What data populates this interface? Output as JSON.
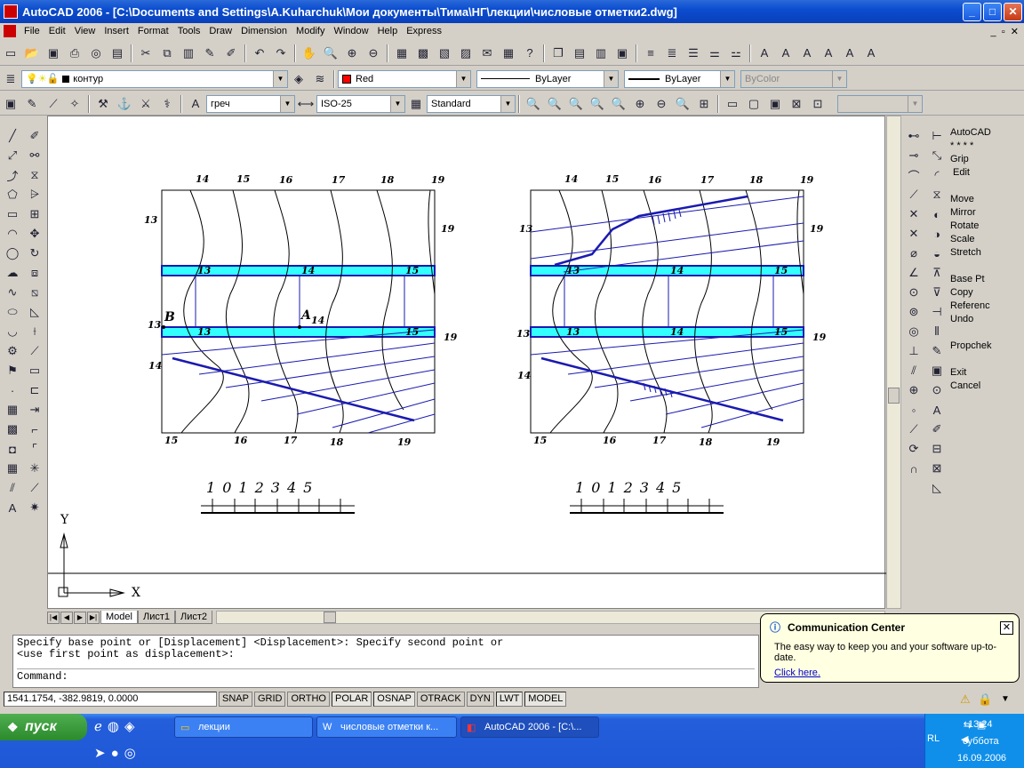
{
  "title": "AutoCAD 2006 - [C:\\Documents and Settings\\A.Kuharchuk\\Мои документы\\Тима\\НГ\\лекции\\числовые отметки2.dwg]",
  "menu": [
    "File",
    "Edit",
    "View",
    "Insert",
    "Format",
    "Tools",
    "Draw",
    "Dimension",
    "Modify",
    "Window",
    "Help",
    "Express"
  ],
  "layers": {
    "layer_name": "контур",
    "color": "Red",
    "linetype": "ByLayer",
    "lineweight": "ByLayer",
    "plotstyle": "ByColor"
  },
  "styles": {
    "text_style": "греч",
    "dim_style": "ISO-25",
    "table_style": "Standard"
  },
  "right_menu": [
    "AutoCAD",
    "* * * *",
    "Grip",
    "Edit",
    "",
    "Move",
    "Mirror",
    "Rotate",
    "Scale",
    "Stretch",
    "",
    "Base Pt",
    "Copy",
    "Referenc",
    "Undo",
    "",
    "Propchek",
    "",
    "Exit",
    "Cancel"
  ],
  "tabs": [
    "Model",
    "Лист1",
    "Лист2"
  ],
  "command": {
    "line1": "Specify base point or [Displacement] <Displacement>: Specify second point or",
    "line2": "<use first point as displacement>:",
    "prompt": "Command:"
  },
  "status": {
    "coords": "1541.1754, -382.9819, 0.0000",
    "buttons": [
      {
        "label": "SNAP",
        "on": false
      },
      {
        "label": "GRID",
        "on": false
      },
      {
        "label": "ORTHO",
        "on": false
      },
      {
        "label": "POLAR",
        "on": true
      },
      {
        "label": "OSNAP",
        "on": true
      },
      {
        "label": "OTRACK",
        "on": false
      },
      {
        "label": "DYN",
        "on": false
      },
      {
        "label": "LWT",
        "on": true
      },
      {
        "label": "MODEL",
        "on": true
      }
    ]
  },
  "balloon": {
    "title": "Communication Center",
    "text": "The easy way to keep you and your software up-to-date.",
    "link": "Click here."
  },
  "taskbar": {
    "start": "пуск",
    "tasks": [
      "лекции",
      "числовые отметки к...",
      "AutoCAD 2006 - [C:\\..."
    ],
    "lang": "RL",
    "time": "13:24",
    "day": "суббота",
    "date": "16.09.2006"
  },
  "drawing": {
    "left_top_labels": [
      "14",
      "15",
      "16",
      "17",
      "18",
      "19"
    ],
    "left_side_labels": [
      "13",
      "13",
      "14"
    ],
    "left_right_labels": [
      "19",
      "19"
    ],
    "band_labels": [
      "13",
      "14",
      "15"
    ],
    "bottom_labels": [
      "15",
      "16",
      "17",
      "18",
      "19"
    ],
    "point_labels": [
      "B",
      "A",
      "14"
    ],
    "scale_numbers": [
      "1",
      "0",
      "1",
      "2",
      "3",
      "4",
      "5"
    ],
    "axis_y": "Y",
    "axis_x": "X"
  },
  "colors": {
    "accent": "#0a3fb8",
    "band": "#33ffff",
    "lines": "#1a1ab0"
  }
}
